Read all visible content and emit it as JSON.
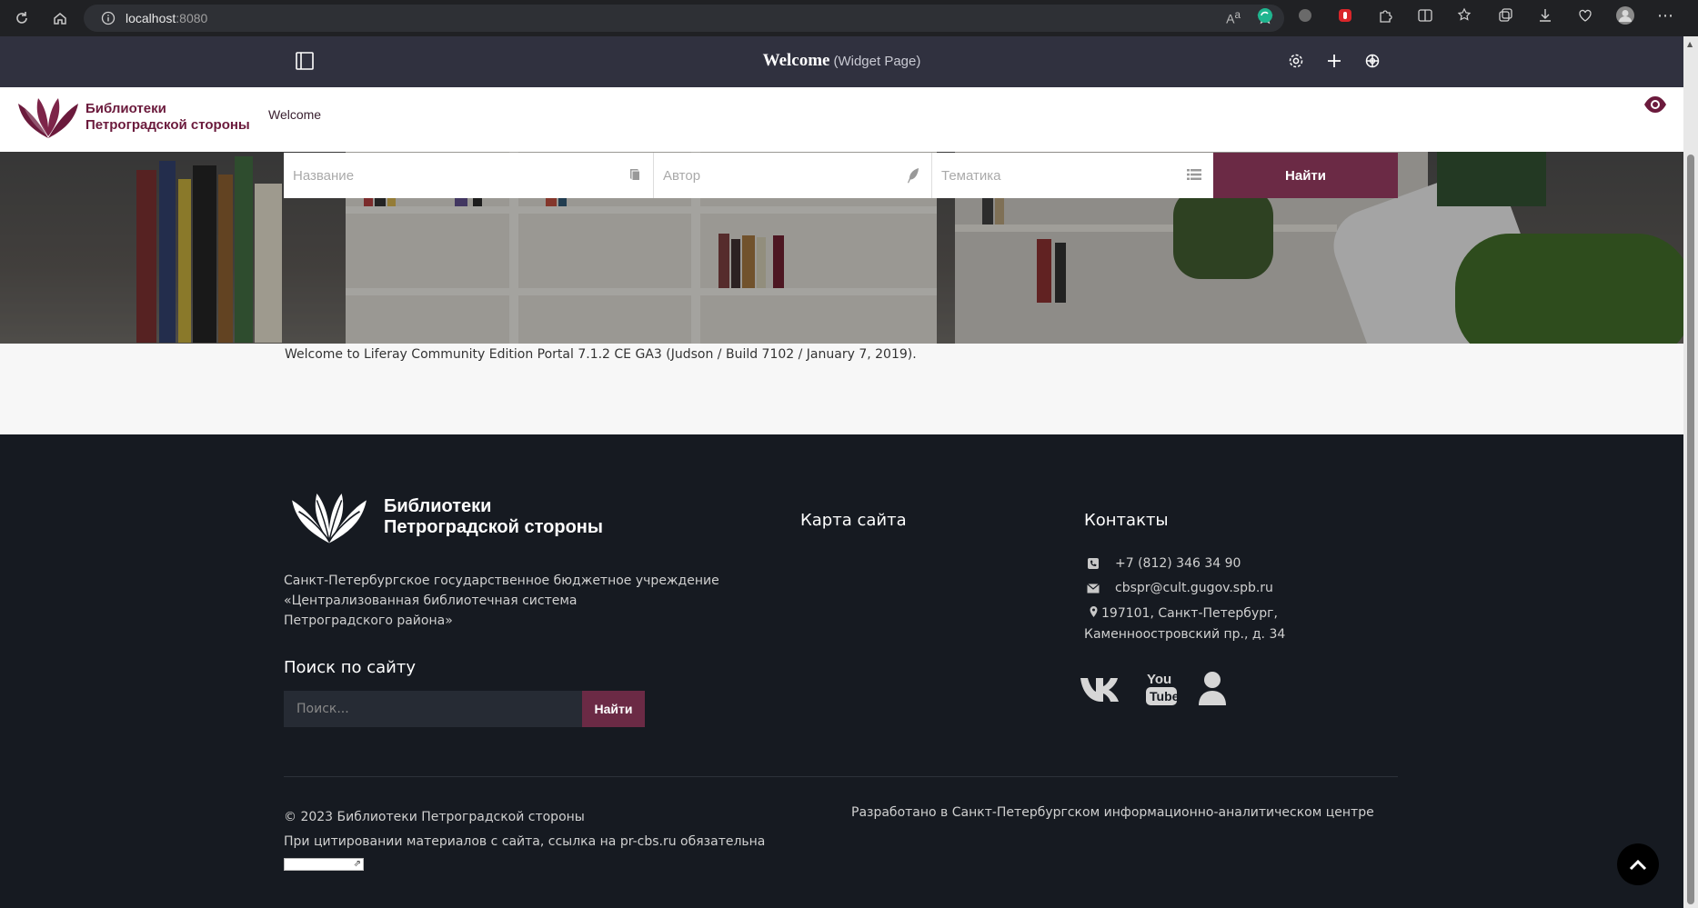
{
  "browser": {
    "url_host": "localhost",
    "url_port": ":8080"
  },
  "control_menu": {
    "title": "Welcome",
    "subtitle": "(Widget Page)"
  },
  "header": {
    "logo_line1": "Библиотеки",
    "logo_line2": "Петроградской стороны",
    "nav_item": "Welcome"
  },
  "search": {
    "title_placeholder": "Название",
    "author_placeholder": "Автор",
    "topic_placeholder": "Тематика",
    "button": "Найти"
  },
  "content": {
    "welcome_message": "Welcome to Liferay Community Edition Portal 7.1.2 CE GA3 (Judson / Build 7102 / January 7, 2019)."
  },
  "footer": {
    "logo_line1": "Библиотеки",
    "logo_line2": "Петроградской стороны",
    "org_line1": "Санкт-Петербургское государственное бюджетное учреждение",
    "org_line2": "«Централизованная библиотечная система",
    "org_line3": "Петроградского района»",
    "site_search_heading": "Поиск по сайту",
    "site_search_placeholder": "Поиск...",
    "site_search_button": "Найти",
    "sitemap_heading": "Карта сайта",
    "contacts_heading": "Контакты",
    "phone": "+7 (812) 346 34 90",
    "email": "cbspr@cult.gugov.spb.ru",
    "address_line1": "197101, Санкт-Петербург,",
    "address_line2": "Каменноостровский пр., д. 34",
    "copyright": "© 2023 Библиотеки Петроградской стороны",
    "citation": "При цитировании материалов с сайта, ссылка на pr-cbs.ru обязательна",
    "developed_by": "Разработано в Санкт-Петербургском информационно-аналитическом центре"
  },
  "colors": {
    "brand": "#6b2a45",
    "footer_bg": "#161a21",
    "control_menu_bg": "#30313f"
  }
}
